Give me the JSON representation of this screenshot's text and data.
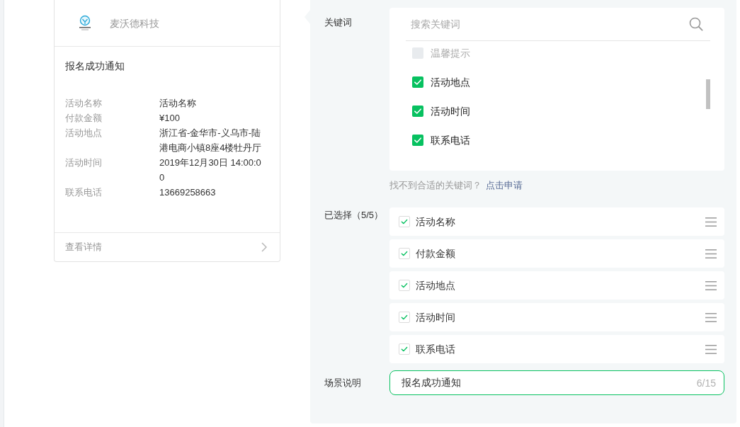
{
  "preview_card": {
    "company": "麦沃德科技",
    "title": "报名成功通知",
    "fields": [
      {
        "label": "活动名称",
        "value": "活动名称"
      },
      {
        "label": "付款金额",
        "value": "¥100"
      },
      {
        "label": "活动地点",
        "value": "浙江省-金华市-义乌市-陆港电商小镇8座4楼牡丹厅"
      },
      {
        "label": "活动时间",
        "value": "2019年12月30日 14:00:00"
      },
      {
        "label": "联系电话",
        "value": "13669258663"
      }
    ],
    "footer_link": "查看详情"
  },
  "settings_panel": {
    "keywords": {
      "label": "关键词",
      "search": {
        "placeholder": "搜索关键词"
      },
      "options": [
        {
          "label": "温馨提示",
          "checked": false,
          "disabled": true
        },
        {
          "label": "活动地点",
          "checked": true,
          "disabled": false
        },
        {
          "label": "活动时间",
          "checked": true,
          "disabled": false
        },
        {
          "label": "联系电话",
          "checked": true,
          "disabled": false
        }
      ]
    },
    "hint": {
      "text": "找不到合适的关键词？",
      "link": "点击申请"
    },
    "selected": {
      "label": "已选择（5/5）",
      "items": [
        {
          "label": "活动名称",
          "checked": true
        },
        {
          "label": "付款金额",
          "checked": true
        },
        {
          "label": "活动地点",
          "checked": true
        },
        {
          "label": "活动时间",
          "checked": true
        },
        {
          "label": "联系电话",
          "checked": true
        }
      ]
    },
    "scene": {
      "label": "场景说明",
      "value": "报名成功通知",
      "counter": "6/15"
    }
  }
}
